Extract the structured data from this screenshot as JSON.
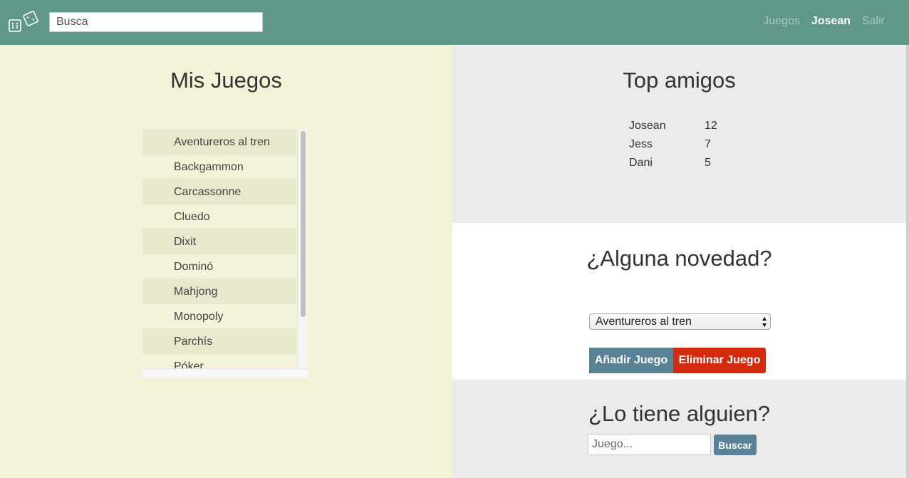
{
  "navbar": {
    "logo_icon": "dice-icon",
    "search_placeholder": "Busca",
    "links": [
      {
        "label": "Juegos",
        "active": false
      },
      {
        "label": "Josean",
        "active": true
      },
      {
        "label": "Salir",
        "active": false
      }
    ]
  },
  "my_games": {
    "title": "Mis Juegos",
    "items": [
      "Aventureros al tren",
      "Backgammon",
      "Carcassonne",
      "Cluedo",
      "Dixit",
      "Dominó",
      "Mahjong",
      "Monopoly",
      "Parchís",
      "Póker"
    ]
  },
  "top_friends": {
    "title": "Top amigos",
    "rows": [
      {
        "name": "Josean",
        "score": "12"
      },
      {
        "name": "Jess",
        "score": "7"
      },
      {
        "name": "Dani",
        "score": "5"
      }
    ]
  },
  "news": {
    "title": "¿Alguna novedad?",
    "selected_game": "Aventureros al tren",
    "add_label": "Añadir Juego",
    "remove_label": "Eliminar Juego"
  },
  "who_has": {
    "title": "¿Lo tiene alguien?",
    "input_placeholder": "Juego...",
    "search_label": "Buscar"
  },
  "colors": {
    "navbar": "#5f9889",
    "left_panel": "#f4f2d8",
    "right_panel": "#ebebeb",
    "button_primary": "#5a8296",
    "button_danger": "#d42a0e"
  }
}
